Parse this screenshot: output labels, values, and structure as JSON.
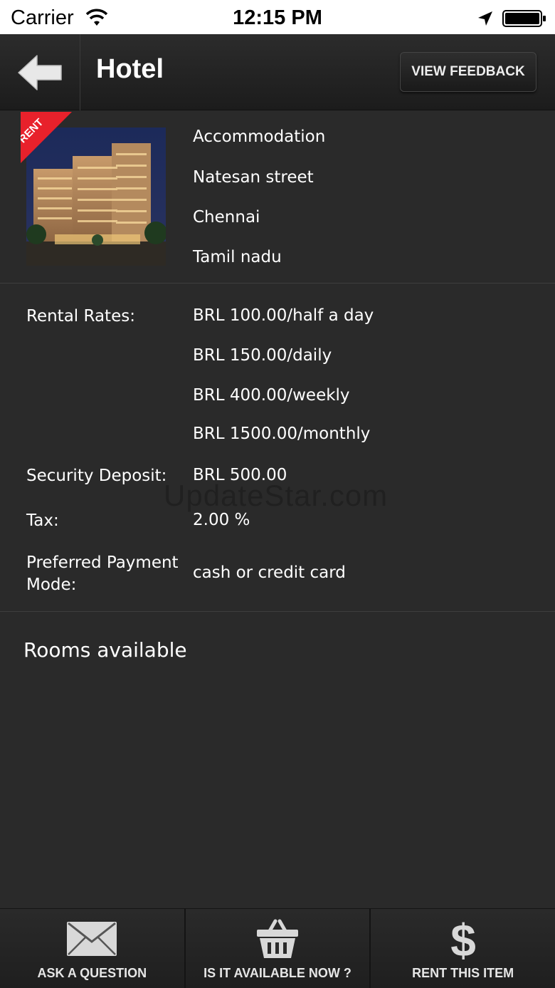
{
  "status_bar": {
    "carrier": "Carrier",
    "time": "12:15 PM",
    "icons": [
      "wifi-icon",
      "location-arrow-icon",
      "battery-icon"
    ]
  },
  "nav": {
    "back_icon": "back-arrow-icon",
    "title": "Hotel",
    "feedback_label": "VIEW FEEDBACK"
  },
  "listing": {
    "ribbon": "RENT",
    "image": "hotel-building-photo",
    "category": "Accommodation",
    "street": "Natesan street",
    "city": "Chennai",
    "state": "Tamil nadu"
  },
  "rates": {
    "rental_label": "Rental Rates:",
    "rental_values": [
      "BRL 100.00/half a day",
      "BRL 150.00/daily",
      "BRL 400.00/weekly",
      "BRL 1500.00/monthly"
    ],
    "deposit_label": "Security Deposit:",
    "deposit_value": "BRL 500.00",
    "tax_label": "Tax:",
    "tax_value": "2.00 %",
    "payment_label_1": "Preferred Payment",
    "payment_label_2": "Mode:",
    "payment_value": "cash or credit card"
  },
  "watermark": "UpdateStar.com",
  "rooms_heading": "Rooms available",
  "toolbar": [
    {
      "label": "ASK A QUESTION",
      "icon": "envelope-icon"
    },
    {
      "label": "IS IT AVAILABLE NOW ?",
      "icon": "basket-icon"
    },
    {
      "label": "RENT THIS ITEM",
      "icon": "dollar-icon"
    }
  ],
  "colors": {
    "background": "#2a2a2a",
    "ribbon": "#e8212b",
    "text": "#ffffff"
  }
}
